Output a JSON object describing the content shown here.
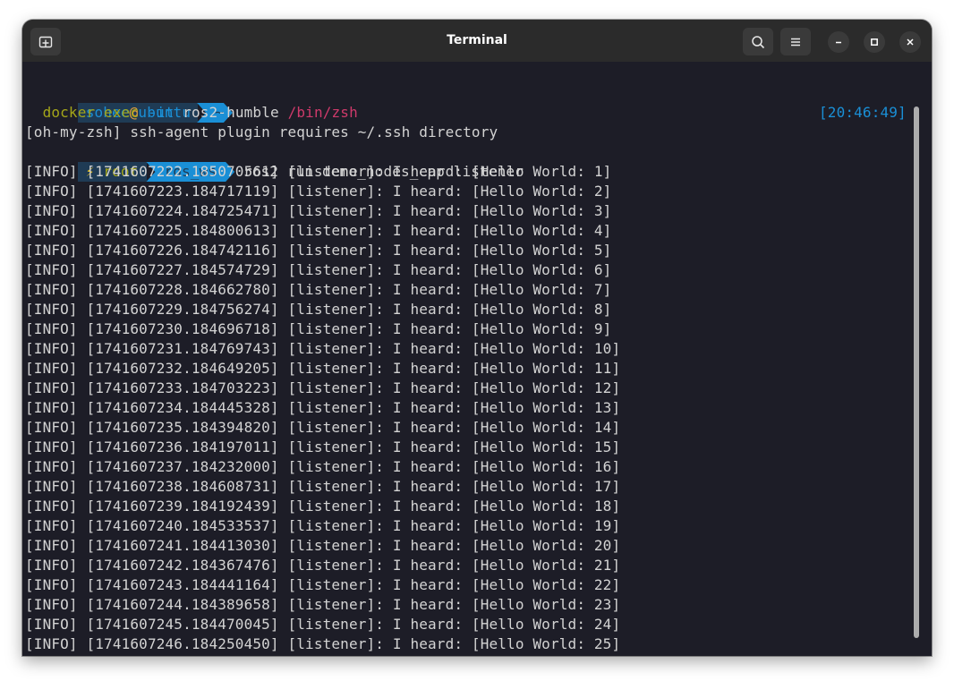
{
  "window": {
    "title": "Terminal"
  },
  "titlebar": {
    "new_tab_icon": "new-tab-icon",
    "search_icon": "search-icon",
    "menu_icon": "hamburger-menu-icon",
    "minimize_icon": "minimize-icon",
    "maximize_icon": "maximize-icon",
    "close_icon": "close-icon"
  },
  "prompt1": {
    "user": "sohee",
    "at": "@",
    "host": "ubuntu",
    "dir": "~",
    "cmd_docker": "docker",
    "cmd_exec": "exec",
    "cmd_flag": "-it",
    "cmd_container": "ros2-humble",
    "cmd_shell": "/bin/zsh",
    "time": "[20:46:49]"
  },
  "notice": "[oh-my-zsh] ssh-agent plugin requires ~/.ssh directory",
  "prompt2": {
    "bolt": "⚡",
    "user": "root",
    "dir": "ros_ws",
    "command": "ros2 run demo_nodes_cpp listener"
  },
  "log_lines": [
    "[INFO] [1741607222.185070561] [listener]: I heard: [Hello World: 1]",
    "[INFO] [1741607223.184717119] [listener]: I heard: [Hello World: 2]",
    "[INFO] [1741607224.184725471] [listener]: I heard: [Hello World: 3]",
    "[INFO] [1741607225.184800613] [listener]: I heard: [Hello World: 4]",
    "[INFO] [1741607226.184742116] [listener]: I heard: [Hello World: 5]",
    "[INFO] [1741607227.184574729] [listener]: I heard: [Hello World: 6]",
    "[INFO] [1741607228.184662780] [listener]: I heard: [Hello World: 7]",
    "[INFO] [1741607229.184756274] [listener]: I heard: [Hello World: 8]",
    "[INFO] [1741607230.184696718] [listener]: I heard: [Hello World: 9]",
    "[INFO] [1741607231.184769743] [listener]: I heard: [Hello World: 10]",
    "[INFO] [1741607232.184649205] [listener]: I heard: [Hello World: 11]",
    "[INFO] [1741607233.184703223] [listener]: I heard: [Hello World: 12]",
    "[INFO] [1741607234.184445328] [listener]: I heard: [Hello World: 13]",
    "[INFO] [1741607235.184394820] [listener]: I heard: [Hello World: 14]",
    "[INFO] [1741607236.184197011] [listener]: I heard: [Hello World: 15]",
    "[INFO] [1741607237.184232000] [listener]: I heard: [Hello World: 16]",
    "[INFO] [1741607238.184608731] [listener]: I heard: [Hello World: 17]",
    "[INFO] [1741607239.184192439] [listener]: I heard: [Hello World: 18]",
    "[INFO] [1741607240.184533537] [listener]: I heard: [Hello World: 19]",
    "[INFO] [1741607241.184413030] [listener]: I heard: [Hello World: 20]",
    "[INFO] [1741607242.184367476] [listener]: I heard: [Hello World: 21]",
    "[INFO] [1741607243.184441164] [listener]: I heard: [Hello World: 22]",
    "[INFO] [1741607244.184389658] [listener]: I heard: [Hello World: 23]",
    "[INFO] [1741607245.184470045] [listener]: I heard: [Hello World: 24]",
    "[INFO] [1741607246.184250450] [listener]: I heard: [Hello World: 25]"
  ],
  "colors": {
    "terminal_bg": "#1d1d27",
    "titlebar_bg": "#2b2b2b",
    "segment_blue": "#1a8fd6",
    "segment_dark": "#1f3b55",
    "username_blue": "#1a8fd6",
    "host_blue": "#1a8fd6",
    "command_yellow": "#a4a619",
    "path_pink": "#cf3a6b"
  }
}
